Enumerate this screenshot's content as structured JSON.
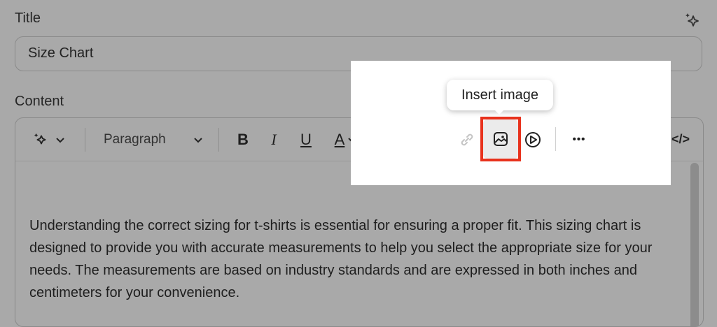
{
  "title_field": {
    "label": "Title",
    "value": "Size Chart"
  },
  "content_field": {
    "label": "Content"
  },
  "toolbar": {
    "paragraph_style": "Paragraph",
    "bold_label": "B",
    "italic_label": "I",
    "underline_label": "U",
    "text_color_label": "A",
    "more_label": "•••",
    "code_label": "</>"
  },
  "tooltip": {
    "text": "Insert image"
  },
  "editor_body": "Understanding the correct sizing for t-shirts is essential for ensuring a proper fit. This sizing chart is designed to provide you with accurate measurements to help you select the appropriate size for your needs. The measurements are based on industry standards and are expressed in both inches and centimeters for your convenience.",
  "colors": {
    "highlight": "#e8321d",
    "overlay": "#a9a9a9"
  }
}
